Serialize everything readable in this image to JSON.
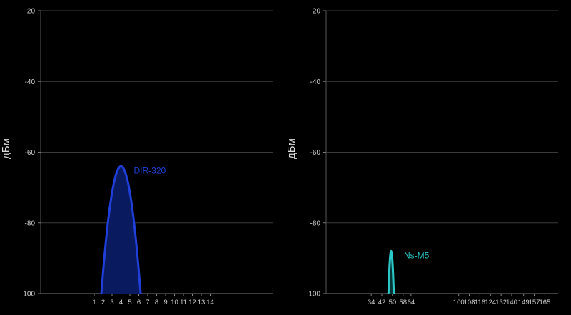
{
  "chart_data": [
    {
      "type": "area",
      "title": "",
      "ylabel": "дБм",
      "xlabel": "",
      "ylim": [
        -100,
        -20
      ],
      "y_ticks": [
        "-20",
        "-40",
        "-60",
        "-80",
        "-100"
      ],
      "y_tick_values": [
        -20,
        -40,
        -60,
        -80,
        -100
      ],
      "x_range": [
        -5,
        21
      ],
      "x_ticks": [
        "1",
        "2",
        "3",
        "4",
        "5",
        "6",
        "7",
        "8",
        "9",
        "10",
        "11",
        "12",
        "13",
        "14"
      ],
      "x_tick_values": [
        1,
        2,
        3,
        4,
        5,
        6,
        7,
        8,
        9,
        10,
        11,
        12,
        13,
        14
      ],
      "grid": true,
      "series": [
        {
          "name": "DIR-320",
          "center": 4,
          "halfwidth": 2.2,
          "peak": -64,
          "color": "#1f3fd8",
          "fill": "#0a1a5e"
        }
      ]
    },
    {
      "type": "area",
      "title": "",
      "ylabel": "дБм",
      "xlabel": "",
      "ylim": [
        -100,
        -20
      ],
      "y_ticks": [
        "-20",
        "-40",
        "-60",
        "-80",
        "-100"
      ],
      "y_tick_values": [
        -20,
        -40,
        -60,
        -80,
        -100
      ],
      "x_range": [
        0,
        175
      ],
      "x_ticks": [
        "34",
        "42",
        "50",
        "58",
        "64",
        "100",
        "108",
        "116",
        "124",
        "132",
        "140",
        "149",
        "157",
        "165"
      ],
      "x_tick_values": [
        34,
        42,
        50,
        58,
        64,
        100,
        108,
        116,
        124,
        132,
        140,
        149,
        157,
        165
      ],
      "grid": true,
      "series": [
        {
          "name": "Ns-M5",
          "center": 49,
          "halfwidth": 2,
          "peak": -88,
          "color": "#2cc8c8",
          "fill": "#08353a"
        }
      ]
    }
  ]
}
